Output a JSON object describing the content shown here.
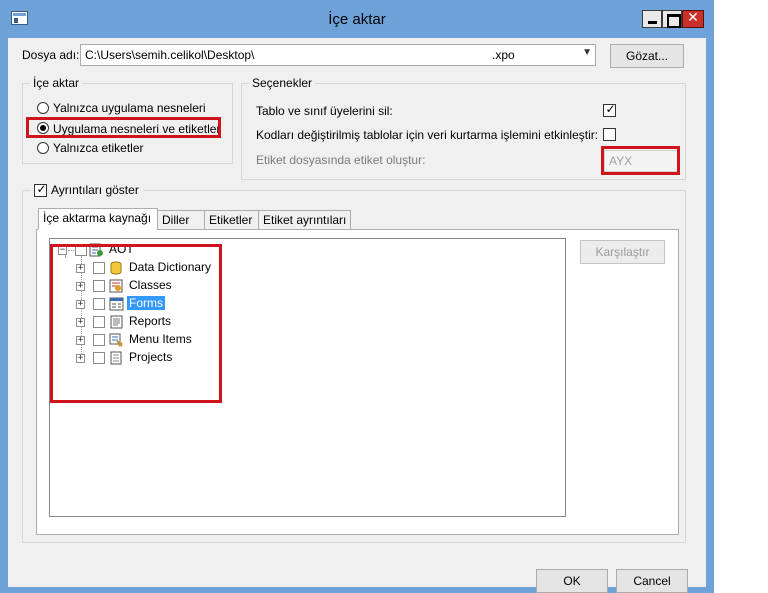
{
  "window": {
    "title": "İçe aktar"
  },
  "file": {
    "label": "Dosya adı:",
    "path": "C:\\Users\\semih.celikol\\Desktop\\",
    "extension": ".xpo",
    "browse_label": "Gözat..."
  },
  "import_group": {
    "title": "İçe aktar",
    "options": [
      {
        "label": "Yalnızca uygulama nesneleri",
        "selected": false
      },
      {
        "label": "Uygulama nesneleri ve etiketler",
        "selected": true
      },
      {
        "label": "Yalnızca etiketler",
        "selected": false
      }
    ]
  },
  "options_group": {
    "title": "Seçenekler",
    "delete_members_label": "Tablo ve sınıf üyelerini sil:",
    "delete_members_checked": true,
    "recovery_label": "Kodları değiştirilmiş tablolar için veri kurtarma işlemini etkinleştir:",
    "recovery_checked": false,
    "label_file_label": "Etiket dosyasında etiket oluştur:",
    "label_file_value": "AYX"
  },
  "details": {
    "show_details_label": "Ayrıntıları göster",
    "show_details_checked": true,
    "tabs": [
      {
        "label": "İçe aktarma kaynağı",
        "active": true
      },
      {
        "label": "Diller",
        "active": false
      },
      {
        "label": "Etiketler",
        "active": false
      },
      {
        "label": "Etiket ayrıntıları",
        "active": false
      }
    ],
    "compare_label": "Karşılaştır",
    "tree": {
      "root": "AOT",
      "children": [
        "Data Dictionary",
        "Classes",
        "Forms",
        "Reports",
        "Menu Items",
        "Projects"
      ],
      "selected": "Forms"
    }
  },
  "footer": {
    "ok_label": "OK",
    "cancel_label": "Cancel"
  },
  "colors": {
    "titlebar": "#6fa2d8",
    "close_button": "#c7312a",
    "highlight_box": "#d0141b",
    "tree_selection": "#3399ff"
  }
}
